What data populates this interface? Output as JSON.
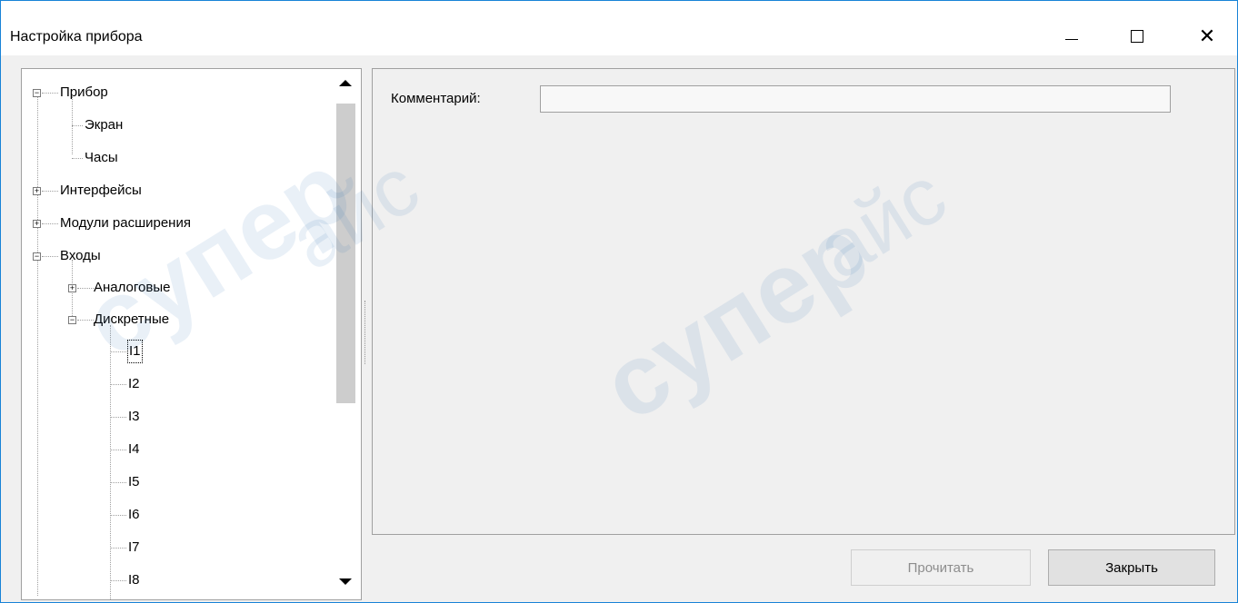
{
  "window": {
    "title": "Настройка прибора",
    "minimize_icon": "minimize-icon",
    "maximize_icon": "maximize-icon",
    "close_icon": "close-icon"
  },
  "tree": {
    "nodes": [
      {
        "label": "Прибор",
        "state": "expanded"
      },
      {
        "label": "Экран",
        "state": "leaf"
      },
      {
        "label": "Часы",
        "state": "leaf"
      },
      {
        "label": "Интерфейсы",
        "state": "collapsed"
      },
      {
        "label": "Модули расширения",
        "state": "collapsed"
      },
      {
        "label": "Входы",
        "state": "expanded"
      },
      {
        "label": "Аналоговые",
        "state": "collapsed"
      },
      {
        "label": "Дискретные",
        "state": "expanded"
      },
      {
        "label": "I1",
        "state": "leaf",
        "selected": true
      },
      {
        "label": "I2",
        "state": "leaf"
      },
      {
        "label": "I3",
        "state": "leaf"
      },
      {
        "label": "I4",
        "state": "leaf"
      },
      {
        "label": "I5",
        "state": "leaf"
      },
      {
        "label": "I6",
        "state": "leaf"
      },
      {
        "label": "I7",
        "state": "leaf"
      },
      {
        "label": "I8",
        "state": "leaf"
      }
    ]
  },
  "content": {
    "comment_label": "Комментарий:",
    "comment_value": ""
  },
  "buttons": {
    "read_label": "Прочитать",
    "close_label": "Закрыть"
  },
  "watermark": {
    "text": "супер",
    "text2": "айс"
  }
}
